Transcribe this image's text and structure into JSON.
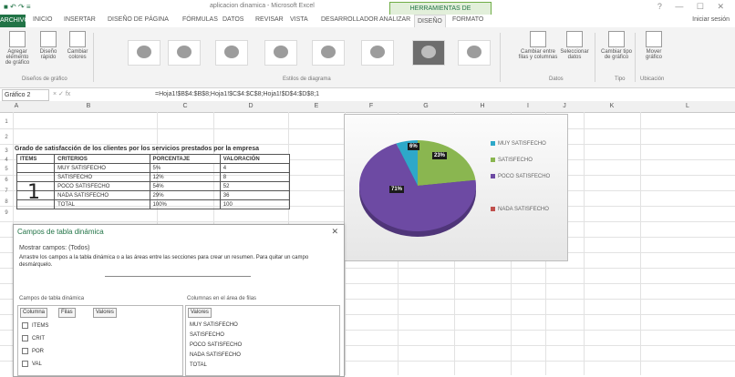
{
  "titlebar": {
    "qa": "■ ↶ ↷ ≡",
    "title": "aplicacion dinamica - Microsoft Excel",
    "context_tab": "HERRAMIENTAS DE",
    "window_controls": "? — ☐ ✕"
  },
  "tabs": [
    "ARCHIVO",
    "INICIO",
    "INSERTAR",
    "DISEÑO DE PÁGINA",
    "FÓRMULAS",
    "DATOS",
    "REVISAR",
    "VISTA",
    "DESARROLLADOR",
    "ANALIZAR",
    "DISEÑO",
    "FORMATO"
  ],
  "user": "Iniciar sesión",
  "ribbon": {
    "left_buttons": [
      "Agregar elemento de gráfico",
      "Diseño rápido",
      "Cambiar colores"
    ],
    "left_group": "Diseños de gráfico",
    "style_group": "Estilos de diagrama",
    "right_buttons": [
      "Cambiar entre filas y columnas",
      "Seleccionar datos",
      "Cambiar tipo de gráfico",
      "Mover gráfico"
    ],
    "data_group": "Datos",
    "type_group": "Tipo",
    "location_group": "Ubicación"
  },
  "formulabar": {
    "namebox": "Gráfico 2",
    "fx": "×  ✓  fx",
    "formula": "=Hoja1!$B$4:$B$8;Hoja1!$C$4:$C$8;Hoja1!$D$4:$D$8;1"
  },
  "columns": [
    "A",
    "B",
    "C",
    "D",
    "E",
    "F",
    "G",
    "H",
    "I",
    "J",
    "K",
    "L"
  ],
  "rows": [
    "1",
    "2",
    "3",
    "4",
    "5",
    "6",
    "7",
    "8",
    "9",
    "10",
    "11",
    "12",
    "13",
    "14",
    "15",
    "16",
    "17",
    "18"
  ],
  "sheet": {
    "title": "Grado de satisfacción de los clientes por los servicios prestados por la empresa",
    "headers": [
      "ITEMS",
      "CRITERIOS",
      "PORCENTAJE",
      "VALORACIÓN"
    ],
    "item": "1",
    "rows": [
      [
        "",
        "MUY SATISFECHO",
        "5%",
        "4"
      ],
      [
        "",
        "SATISFECHO",
        "12%",
        "8"
      ],
      [
        "",
        "POCO SATISFECHO",
        "54%",
        "52"
      ],
      [
        "",
        "NADA SATISFECHO",
        "29%",
        "36"
      ],
      [
        "",
        "TOTAL",
        "100%",
        "100"
      ]
    ]
  },
  "chart": {
    "labels": {
      "blue": "6%",
      "green": "23%",
      "purple": "71%"
    },
    "legend": [
      "MUY SATISFECHO",
      "SATISFECHO",
      "POCO SATISFECHO",
      "NADA SATISFECHO"
    ],
    "colors": {
      "blue": "#2ea8c9",
      "green": "#8ab650",
      "purple": "#6d4aa3"
    }
  },
  "chart_data": {
    "type": "pie",
    "categories": [
      "MUY SATISFECHO",
      "SATISFECHO",
      "POCO SATISFECHO",
      "NADA SATISFECHO"
    ],
    "values": [
      6,
      23,
      71,
      0
    ],
    "data_labels": [
      "6%",
      "23%",
      "71%",
      ""
    ]
  },
  "pane": {
    "title": "Campos de tabla dinámica",
    "subtitle": "Mostrar campos: (Todos)",
    "desc": "Arrastre los campos a la tabla dinámica o a las áreas entre las secciones para crear un resumen. Para quitar un campo desmárquelo.",
    "left_caption": "Campos de tabla dinámica",
    "right_caption": "Columnas en el área de filas",
    "left_tabs": [
      "Columna",
      "Filas",
      "Valores"
    ],
    "left_items": [
      "ITEMS",
      "CRIT",
      "POR",
      "VAL"
    ],
    "right_tab": "Valores",
    "right_items": [
      "MUY SATISFECHO",
      "SATISFECHO",
      "POCO SATISFECHO",
      "NADA SATISFECHO",
      "TOTAL"
    ]
  }
}
